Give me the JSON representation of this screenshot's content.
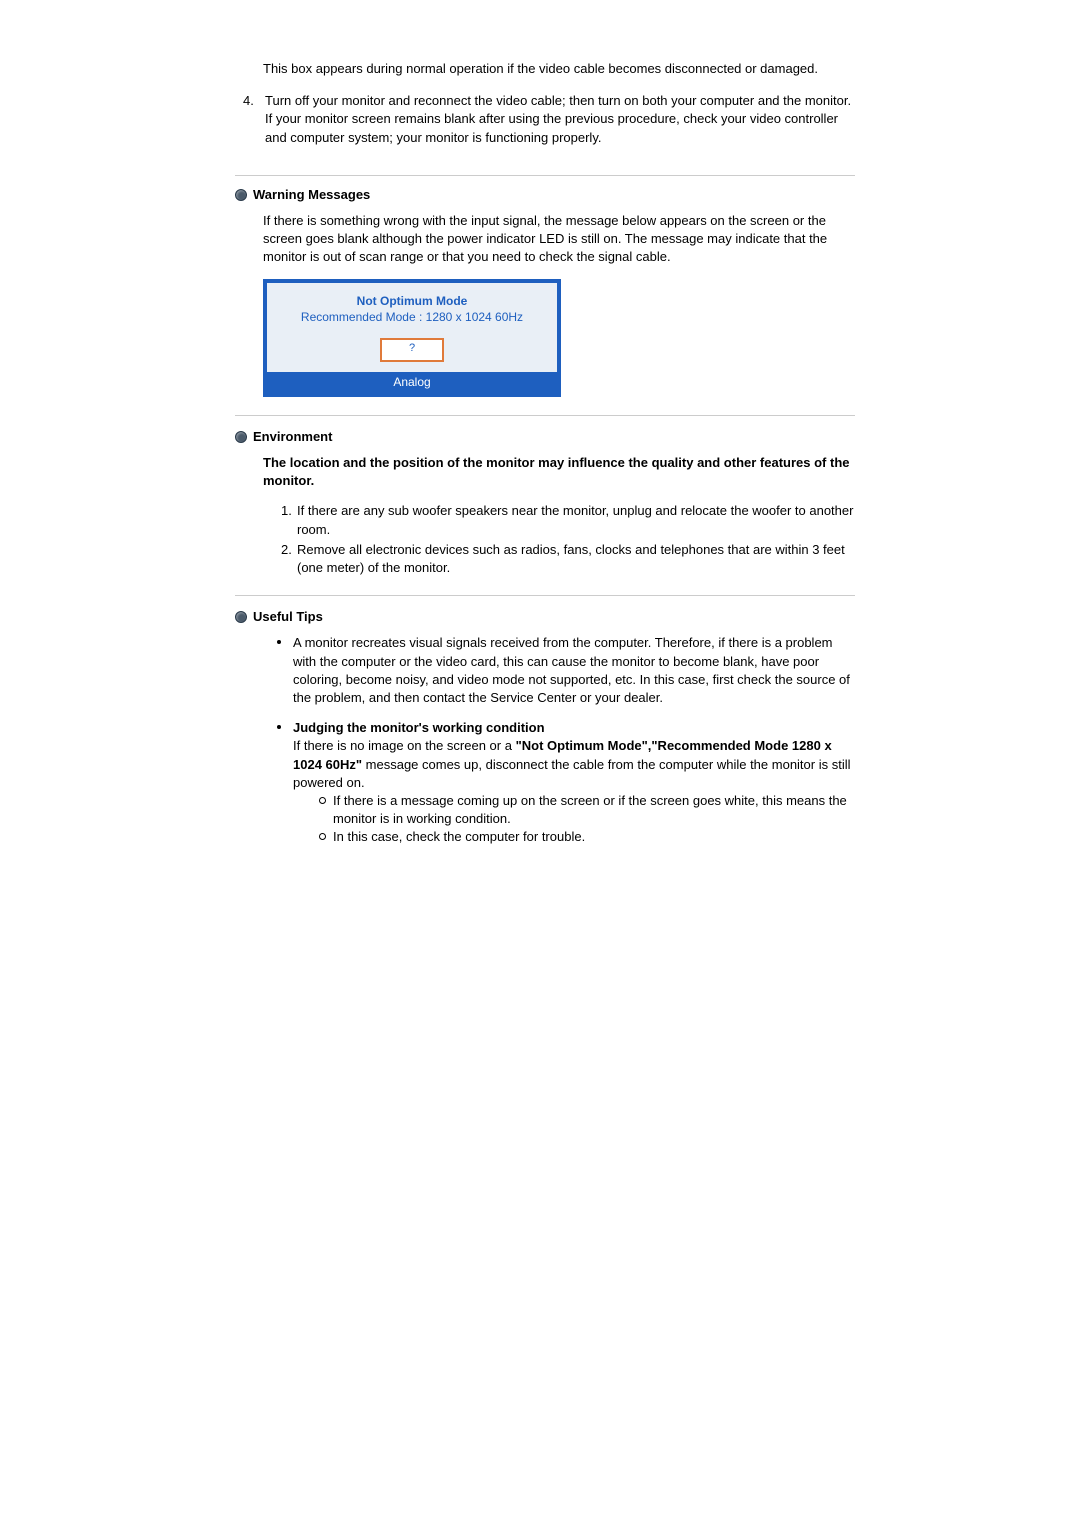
{
  "intro": {
    "pre_text": "This box appears during normal operation if the video cable becomes disconnected or damaged.",
    "step4_num": "4.",
    "step4_a": "Turn off your monitor and reconnect the video cable; then turn on both your computer and the monitor.",
    "step4_b": "If your monitor screen remains blank after using the previous procedure, check your video controller and computer system; your monitor is functioning properly."
  },
  "warning": {
    "title": "Warning Messages",
    "body": "If there is something wrong with the input signal, the message below appears on the screen or the screen goes blank although the power indicator LED is still on. The message may indicate that the monitor is out of scan range or that you need to check the signal cable.",
    "osd": {
      "line1": "Not Optimum Mode",
      "line2": "Recommended Mode : 1280 x 1024  60Hz",
      "btn": "?",
      "footer": "Analog"
    }
  },
  "environment": {
    "title": "Environment",
    "lead": "The location and the position of the monitor may influence the quality and other features of the monitor.",
    "items": [
      {
        "num": "1.",
        "text": "If there are any sub woofer speakers near the monitor, unplug and relocate the woofer to another room."
      },
      {
        "num": "2.",
        "text": "Remove all electronic devices such as radios, fans, clocks and telephones that are within 3 feet (one meter) of the monitor."
      }
    ]
  },
  "tips": {
    "title": "Useful Tips",
    "bullet1": "A monitor recreates visual signals received from the computer. Therefore, if there is a problem with the computer or the video card, this can cause the monitor to become blank, have poor coloring, become noisy, and video mode not supported, etc. In this case, first check the source of the problem, and then contact the Service Center or your dealer.",
    "bullet2_title": "Judging the monitor's working condition",
    "bullet2_pre": "If there is no image on the screen or a ",
    "bullet2_bold": "\"Not Optimum Mode\",\"Recommended Mode 1280 x 1024 60Hz\"",
    "bullet2_post": " message comes up, disconnect the cable from the computer while the monitor is still powered on.",
    "sub": [
      "If there is a message coming up on the screen or if the screen goes white, this means the monitor is in working condition.",
      "In this case, check the computer for trouble."
    ]
  }
}
